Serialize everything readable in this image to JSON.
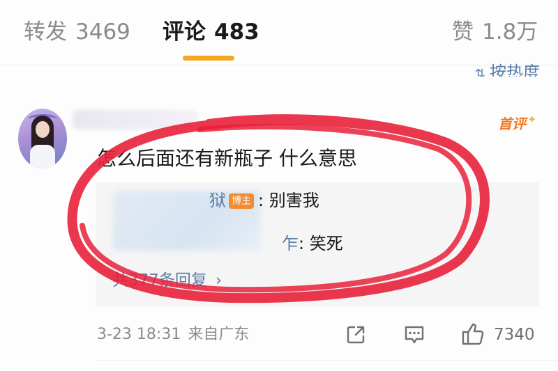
{
  "tabs": {
    "reposts": {
      "label": "转发",
      "count": "3469"
    },
    "comments": {
      "label": "评论",
      "count": "483"
    },
    "likes": {
      "label": "赞",
      "count": "1.8万"
    }
  },
  "sort": {
    "label": "按热度",
    "icon": "sort-icon"
  },
  "comment": {
    "badge": "首评",
    "text": "怎么后面还有新瓶子 什么意思",
    "timestamp": "3-23 18:31",
    "location": "来自广东",
    "like_count": "7340",
    "replies": [
      {
        "name_visible_tail": "狱",
        "author_badge": "博主",
        "text": ": 别害我"
      },
      {
        "name_visible_tail": "乍",
        "text": ": 笑死"
      }
    ],
    "view_replies": "共377条回复"
  },
  "icons": {
    "share": "share-icon",
    "comment": "comment-icon",
    "like": "thumbs-up-icon"
  },
  "colors": {
    "accent": "#f5a623",
    "link": "#5b7da8",
    "badge_orange": "#f28b32",
    "annotation_red": "#e8213a"
  }
}
